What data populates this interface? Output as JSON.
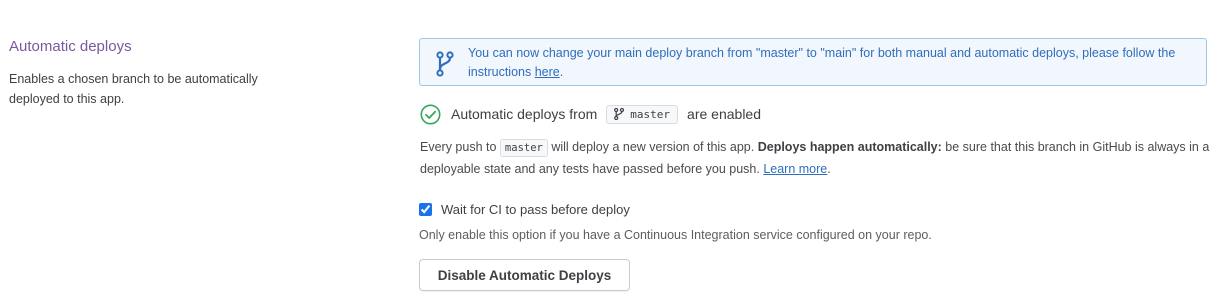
{
  "section": {
    "title": "Automatic deploys",
    "description": "Enables a chosen branch to be automatically deployed to this app."
  },
  "info_box": {
    "text": "You can now change your main deploy branch from \"master\" to \"main\" for both manual and automatic deploys, please follow the instructions ",
    "link_label": "here",
    "suffix": ".",
    "icon": "branch-icon"
  },
  "status": {
    "prefix": "Automatic deploys from",
    "branch": "master",
    "suffix": "are enabled",
    "icon": "check-circle-icon",
    "color": "#3aa55d"
  },
  "push_info": {
    "part1": "Every push to",
    "branch": "master",
    "part2": "will deploy a new version of this app.",
    "bold": "Deploys happen automatically:",
    "part3": "be sure that this branch in GitHub is always in a deployable state and any tests have passed before you push.",
    "link_label": "Learn more",
    "suffix": "."
  },
  "ci_option": {
    "label": "Wait for CI to pass before deploy",
    "checked": true,
    "hint": "Only enable this option if you have a Continuous Integration service configured on your repo."
  },
  "disable_button": {
    "label": "Disable Automatic Deploys"
  }
}
